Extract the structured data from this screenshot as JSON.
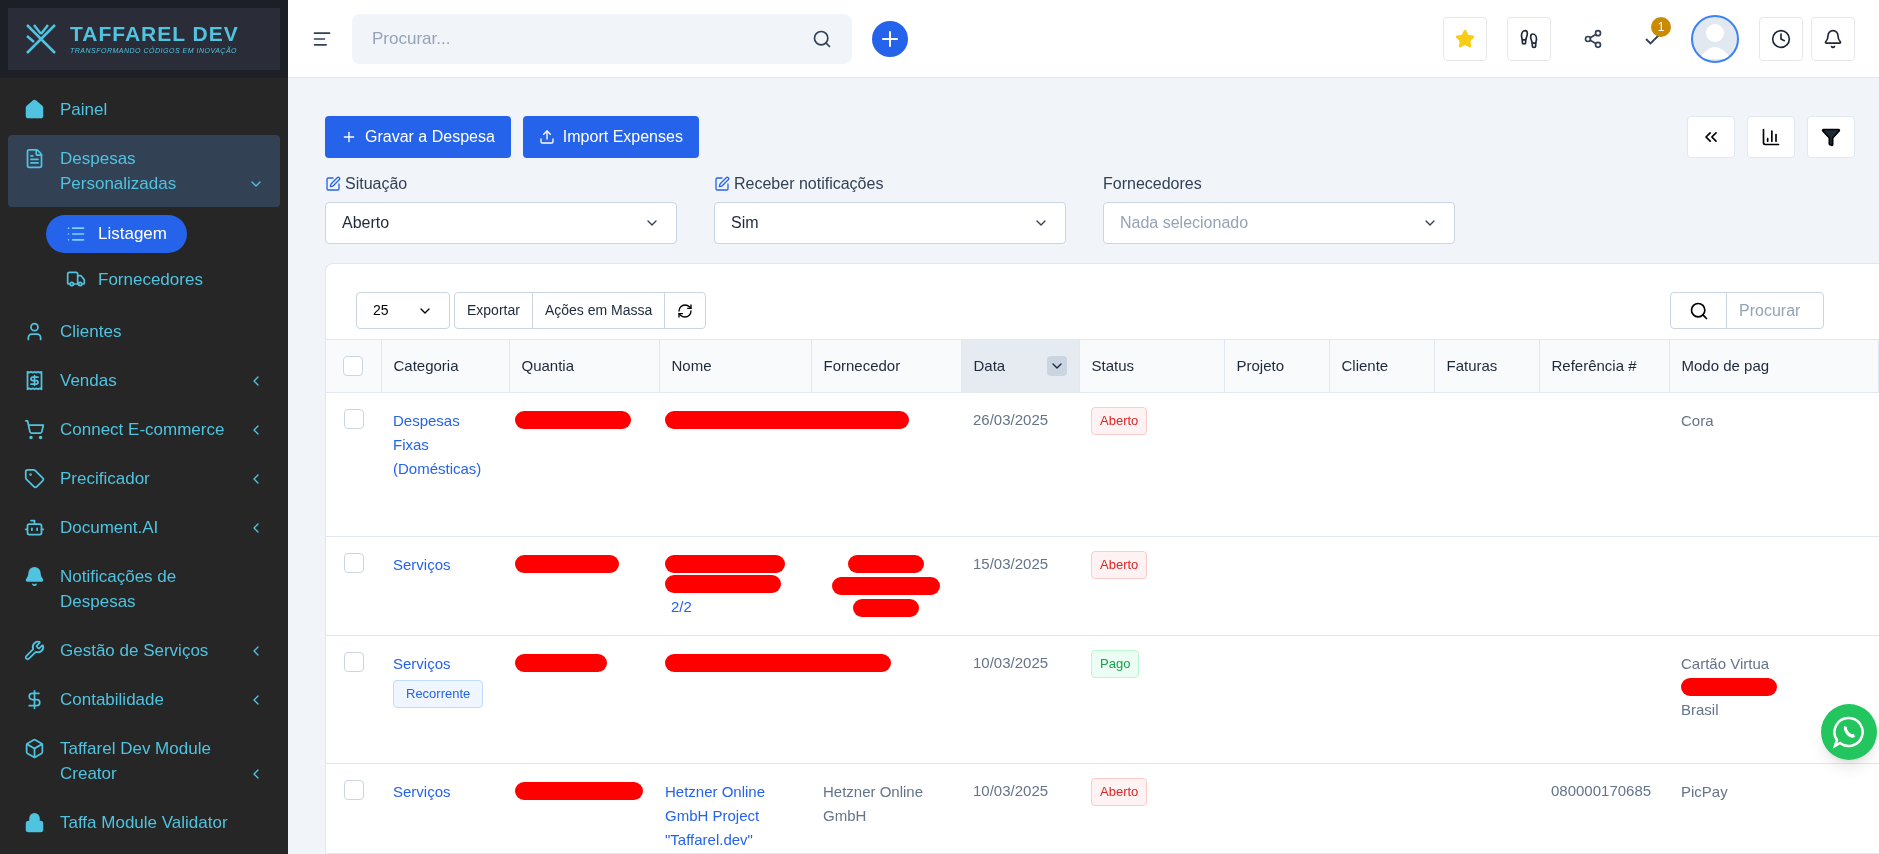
{
  "logo": {
    "title": "TAFFAREL DEV",
    "tagline": "TRANSFORMANDO CÓDIGOS EM INOVAÇÃO"
  },
  "sidebar": {
    "items": [
      {
        "label": "Painel",
        "selected": false
      },
      {
        "label": "Despesas Personalizadas",
        "selected": true,
        "expanded": true,
        "children": [
          {
            "label": "Listagem",
            "selected": true
          },
          {
            "label": "Fornecedores",
            "selected": false
          }
        ]
      },
      {
        "label": "Clientes",
        "selected": false
      },
      {
        "label": "Vendas",
        "selected": false,
        "expanded": false
      },
      {
        "label": "Connect E-commerce",
        "selected": false,
        "expanded": false
      },
      {
        "label": "Precificador",
        "selected": false,
        "expanded": false
      },
      {
        "label": "Document.AI",
        "selected": false,
        "expanded": false
      },
      {
        "label": "Notificações de Despesas",
        "selected": false
      },
      {
        "label": "Gestão de Serviços",
        "selected": false,
        "expanded": false
      },
      {
        "label": "Contabilidade",
        "selected": false,
        "expanded": false
      },
      {
        "label": "Taffarel Dev Module Creator",
        "selected": false,
        "expanded": false
      },
      {
        "label": "Taffa Module Validator",
        "selected": false
      }
    ]
  },
  "header": {
    "search": {
      "placeholder": "Procurar..."
    },
    "tasks_badge": "1"
  },
  "actions": [
    "Gravar a Despesa",
    "Import Expenses"
  ],
  "filters": [
    {
      "label": "Situação",
      "editable": true,
      "value": "Aberto"
    },
    {
      "label": "Receber notificações",
      "editable": true,
      "value": "Sim"
    },
    {
      "label": "Fornecedores",
      "editable": false,
      "placeholder": "Nada selecionado"
    }
  ],
  "table_toolbar": {
    "page_size": "25",
    "buttons": [
      "Exportar",
      "Ações em Massa"
    ],
    "search": {
      "placeholder": "Procurar"
    }
  },
  "table": {
    "select_all_checked": false,
    "columns": [
      {
        "label": "Categoria",
        "sorted": false
      },
      {
        "label": "Quantia",
        "sorted": false
      },
      {
        "label": "Nome",
        "sorted": false
      },
      {
        "label": "Fornecedor",
        "sorted": false
      },
      {
        "label": "Data",
        "sorted": true
      },
      {
        "label": "Status",
        "sorted": false
      },
      {
        "label": "Projeto",
        "sorted": false
      },
      {
        "label": "Cliente",
        "sorted": false
      },
      {
        "label": "Faturas",
        "sorted": false
      },
      {
        "label": "Referência #",
        "sorted": false
      },
      {
        "label": "Modo de pag",
        "sorted": false
      }
    ],
    "rows": [
      {
        "checked": false,
        "category": "Despesas Fixas (Domésticas)",
        "amount_redacted": true,
        "name_redacted": true,
        "date": "26/03/2025",
        "status": {
          "kind": "open",
          "label": "Aberto"
        },
        "payment": [
          "Cora"
        ]
      },
      {
        "checked": false,
        "category": "Serviços",
        "amount_redacted": true,
        "name": "2/2",
        "name_redacted": true,
        "supplier_redacted": true,
        "date": "15/03/2025",
        "status": {
          "kind": "open",
          "label": "Aberto"
        },
        "payment": []
      },
      {
        "checked": false,
        "category": "Serviços",
        "tag": "Recorrente",
        "amount_redacted": true,
        "name_redacted": true,
        "date": "10/03/2025",
        "status": {
          "kind": "paid",
          "label": "Pago"
        },
        "payment": [
          "Cartão Virtua",
          "Brasil"
        ],
        "payment_redacted": true
      },
      {
        "checked": false,
        "category": "Serviços",
        "amount_redacted": true,
        "name": "Hetzner Online GmbH Project \"Taffarel.dev\"",
        "supplier": "Hetzner Online GmbH",
        "date": "10/03/2025",
        "status": {
          "kind": "open",
          "label": "Aberto"
        },
        "reference": "080000170685",
        "payment": [
          "PicPay"
        ]
      }
    ]
  }
}
